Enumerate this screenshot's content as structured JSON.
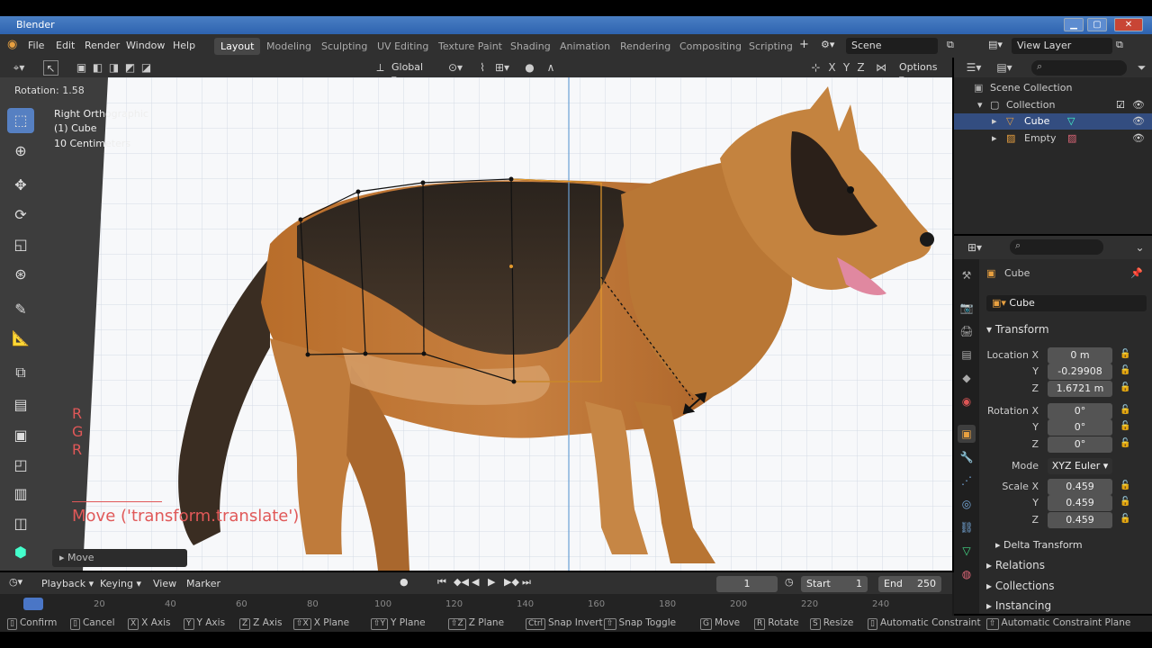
{
  "window": {
    "title": "Blender"
  },
  "menu": {
    "items": [
      "File",
      "Edit",
      "Render",
      "Window",
      "Help"
    ]
  },
  "workspaces": [
    "Layout",
    "Modeling",
    "Sculpting",
    "UV Editing",
    "Texture Paint",
    "Shading",
    "Animation",
    "Rendering",
    "Compositing",
    "Scripting"
  ],
  "scene": {
    "label": "Scene",
    "view_layer": "View Layer"
  },
  "viewport_header": {
    "orientation": "Global",
    "options": "Options",
    "axes": [
      "X",
      "Y",
      "Z"
    ]
  },
  "viewport": {
    "rotation_readout": "Rotation: 1.58",
    "view_name": "Right Orthographic",
    "object_name": "(1) Cube",
    "scale_text": "10 Centimeters",
    "operator_panel": "Move",
    "redo_text": "Move ('transform.translate')",
    "rgr": [
      "R",
      "G",
      "R"
    ]
  },
  "outliner": {
    "root": "Scene Collection",
    "collection": "Collection",
    "items": [
      "Cube",
      "Empty"
    ]
  },
  "properties": {
    "object_name": "Cube",
    "data_name": "Cube",
    "transform_label": "Transform",
    "location_label": "Location X",
    "location": [
      "0 m",
      "-0.29908",
      "1.6721 m"
    ],
    "rotation_label": "Rotation X",
    "rotation": [
      "0°",
      "0°",
      "0°"
    ],
    "y_label": "Y",
    "z_label": "Z",
    "mode_label": "Mode",
    "mode_value": "XYZ Euler",
    "scale_label": "Scale X",
    "scale": [
      "0.459",
      "0.459",
      "0.459"
    ],
    "delta_transform": "Delta Transform",
    "relations": "Relations",
    "collections": "Collections",
    "instancing": "Instancing"
  },
  "timeline": {
    "menus": [
      "Playback",
      "Keying",
      "View",
      "Marker"
    ],
    "current_frame": "1",
    "start_label": "Start",
    "start": "1",
    "end_label": "End",
    "end": "250",
    "ticks": [
      "20",
      "40",
      "60",
      "80",
      "100",
      "120",
      "140",
      "160",
      "180",
      "200",
      "220",
      "240"
    ]
  },
  "statusbar": {
    "items": [
      {
        "key": "",
        "label": "Confirm"
      },
      {
        "key": "",
        "label": "Cancel"
      },
      {
        "key": "X",
        "label": "X Axis"
      },
      {
        "key": "Y",
        "label": "Y Axis"
      },
      {
        "key": "Z",
        "label": "Z Axis"
      },
      {
        "key": "⇧X",
        "label": "X Plane"
      },
      {
        "key": "⇧Y",
        "label": "Y Plane"
      },
      {
        "key": "⇧Z",
        "label": "Z Plane"
      },
      {
        "key": "Ctrl",
        "label": "Snap Invert"
      },
      {
        "key": "⇧",
        "label": "Snap Toggle"
      },
      {
        "key": "G",
        "label": "Move"
      },
      {
        "key": "R",
        "label": "Rotate"
      },
      {
        "key": "S",
        "label": "Resize"
      },
      {
        "key": "",
        "label": "Automatic Constraint"
      },
      {
        "key": "⇧",
        "label": "Automatic Constraint Plane"
      }
    ]
  }
}
